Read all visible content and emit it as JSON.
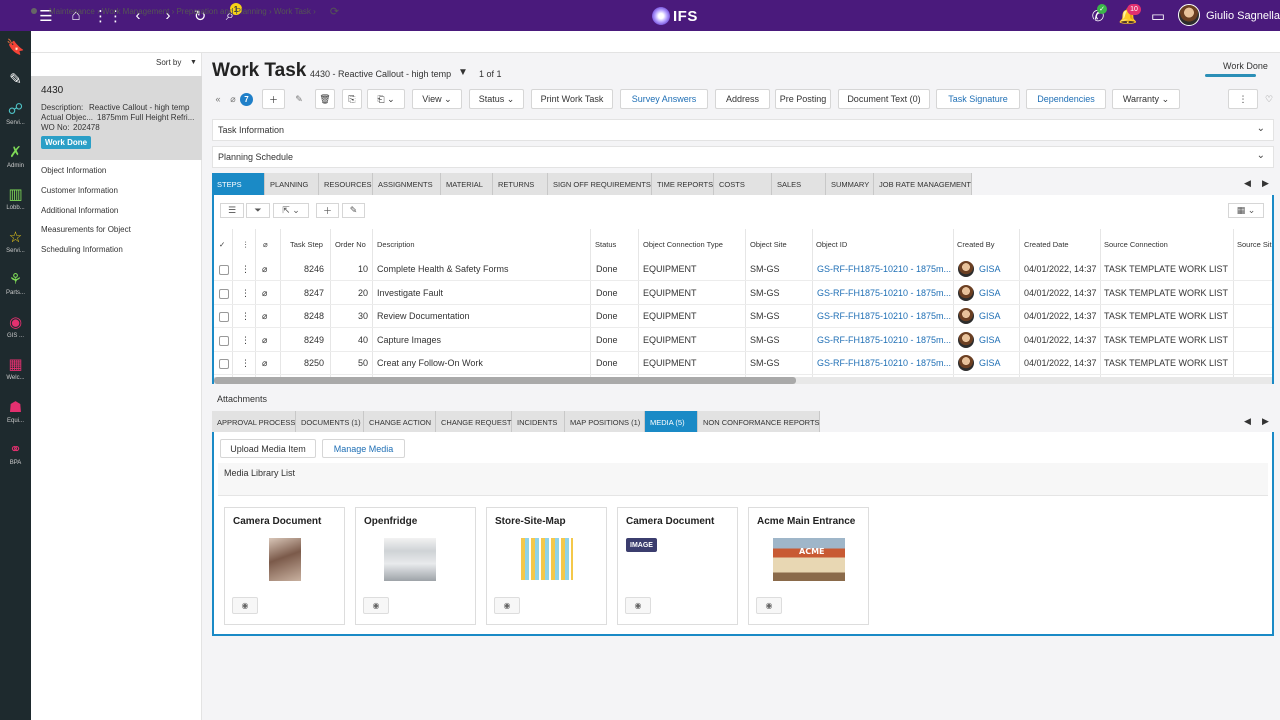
{
  "user": {
    "name": "Giulio Sagnella",
    "search_badge": "1",
    "notif_badge": "10",
    "call_badge": "✓"
  },
  "brand": {
    "name": "IFS"
  },
  "iconbar": [
    {
      "icon": "bookmark-icon",
      "glyph": "🔖",
      "label": ""
    },
    {
      "icon": "pen-icon",
      "glyph": "✎",
      "label": ""
    },
    {
      "icon": "service-icon",
      "glyph": "☍",
      "label": "Servi..."
    },
    {
      "icon": "admin-icon",
      "glyph": "✗",
      "label": "Admin"
    },
    {
      "icon": "lobby-icon",
      "glyph": "▥",
      "label": "Lobb..."
    },
    {
      "icon": "star-icon",
      "glyph": "☆",
      "label": "Servi..."
    },
    {
      "icon": "parts-icon",
      "glyph": "⚘",
      "label": "Parts..."
    },
    {
      "icon": "globe-icon",
      "glyph": "◉",
      "label": "GIS ..."
    },
    {
      "icon": "welcome-icon",
      "glyph": "▦",
      "label": "Welc..."
    },
    {
      "icon": "equipment-icon",
      "glyph": "☗",
      "label": "Equi..."
    },
    {
      "icon": "bpa-icon",
      "glyph": "⚭",
      "label": "BPA"
    }
  ],
  "breadcrumb": [
    "Maintenance",
    "Work Management",
    "Preparation and Planning",
    "Work Task"
  ],
  "record": {
    "sort_by": "Sort by",
    "id": "4430",
    "desc_label": "Description:",
    "desc_value": "Reactive Callout - high temp",
    "obj_label": "Actual Objec...",
    "obj_value": "1875mm Full Height Refri...",
    "wo_label": "WO No:",
    "wo_value": "202478",
    "status": "Work Done"
  },
  "nav_links": [
    "Object Information",
    "Customer Information",
    "Additional Information",
    "Measurements for Object",
    "Scheduling Information"
  ],
  "header": {
    "title": "Work Task",
    "subtitle": "4430 - Reactive Callout - high temp",
    "count": "1 of 1",
    "state": "Work Done"
  },
  "attachment_count": "7",
  "commands": {
    "view": "View",
    "status": "Status",
    "print": "Print Work Task",
    "survey": "Survey Answers",
    "address": "Address",
    "preposting": "Pre Posting",
    "doctext": "Document Text (0)",
    "signature": "Task Signature",
    "dependencies": "Dependencies",
    "warranty": "Warranty"
  },
  "sections": {
    "task_info": "Task Information",
    "planning": "Planning Schedule",
    "attachments": "Attachments"
  },
  "tabs": [
    "STEPS",
    "PLANNING",
    "RESOURCES",
    "ASSIGNMENTS",
    "MATERIAL",
    "RETURNS",
    "SIGN OFF REQUIREMENTS",
    "TIME REPORTS",
    "COSTS",
    "SALES",
    "SUMMARY",
    "JOB RATE MANAGEMENT"
  ],
  "grid": {
    "columns": [
      "Task Step",
      "Order No",
      "Description",
      "Status",
      "Object Connection Type",
      "Object Site",
      "Object ID",
      "Created By",
      "Created Date",
      "Source Connection",
      "Source Sit"
    ],
    "rows": [
      {
        "step": "8246",
        "order": "10",
        "desc": "Complete Health & Safety Forms",
        "status": "Done",
        "conn": "EQUIPMENT",
        "site": "SM-GS",
        "obj": "GS-RF-FH1875-10210 - 1875m...",
        "by": "GISA",
        "date": "04/01/2022, 14:37",
        "src": "TASK TEMPLATE WORK LIST"
      },
      {
        "step": "8247",
        "order": "20",
        "desc": "Investigate Fault",
        "status": "Done",
        "conn": "EQUIPMENT",
        "site": "SM-GS",
        "obj": "GS-RF-FH1875-10210 - 1875m...",
        "by": "GISA",
        "date": "04/01/2022, 14:37",
        "src": "TASK TEMPLATE WORK LIST"
      },
      {
        "step": "8248",
        "order": "30",
        "desc": "Review Documentation",
        "status": "Done",
        "conn": "EQUIPMENT",
        "site": "SM-GS",
        "obj": "GS-RF-FH1875-10210 - 1875m...",
        "by": "GISA",
        "date": "04/01/2022, 14:37",
        "src": "TASK TEMPLATE WORK LIST"
      },
      {
        "step": "8249",
        "order": "40",
        "desc": "Capture Images",
        "status": "Done",
        "conn": "EQUIPMENT",
        "site": "SM-GS",
        "obj": "GS-RF-FH1875-10210 - 1875m...",
        "by": "GISA",
        "date": "04/01/2022, 14:37",
        "src": "TASK TEMPLATE WORK LIST"
      },
      {
        "step": "8250",
        "order": "50",
        "desc": "Creat any Follow-On Work",
        "status": "Done",
        "conn": "EQUIPMENT",
        "site": "SM-GS",
        "obj": "GS-RF-FH1875-10210 - 1875m...",
        "by": "GISA",
        "date": "04/01/2022, 14:37",
        "src": "TASK TEMPLATE WORK LIST"
      }
    ]
  },
  "attach_tabs": [
    "APPROVAL PROCESS",
    "DOCUMENTS (1)",
    "CHANGE ACTION",
    "CHANGE REQUEST",
    "INCIDENTS",
    "MAP POSITIONS (1)",
    "MEDIA (5)",
    "NON CONFORMANCE REPORTS"
  ],
  "media": {
    "upload": "Upload Media Item",
    "manage": "Manage Media",
    "list_title": "Media Library List",
    "items": [
      {
        "title": "Camera Document",
        "kind": "photo"
      },
      {
        "title": "Openfridge",
        "kind": "photo"
      },
      {
        "title": "Store-Site-Map",
        "kind": "photo"
      },
      {
        "title": "Camera Document",
        "kind": "tag",
        "tag": "IMAGE"
      },
      {
        "title": "Acme Main Entrance",
        "kind": "photo",
        "sign": "ACME"
      }
    ]
  },
  "colors": {
    "brand": "#4a1a7c",
    "accent": "#1a8ac6",
    "link": "#1f6fb5"
  }
}
